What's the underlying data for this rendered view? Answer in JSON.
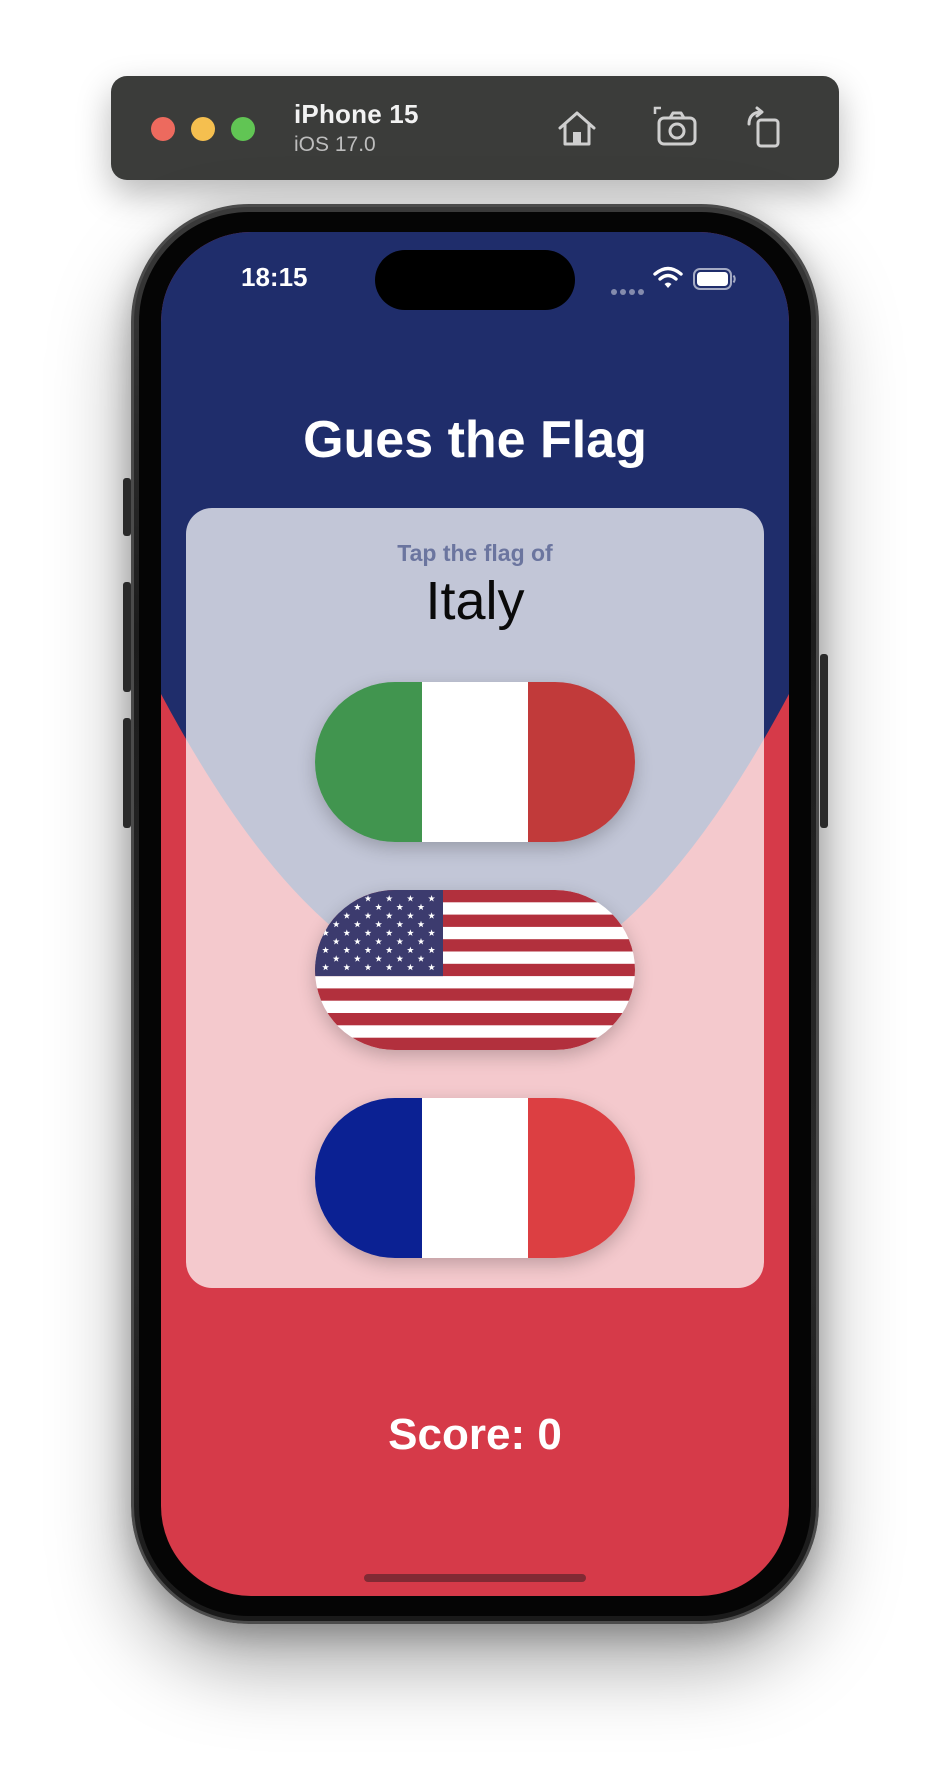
{
  "simulator": {
    "device_name": "iPhone 15",
    "os_version": "iOS 17.0",
    "icons": [
      "home-icon",
      "screenshot-icon",
      "rotate-icon"
    ]
  },
  "status_bar": {
    "time": "18:15",
    "icons": [
      "cellular-dots-icon",
      "wifi-icon",
      "battery-icon"
    ]
  },
  "app": {
    "title": "Gues the Flag",
    "prompt": "Tap the flag of",
    "country": "Italy",
    "flags": [
      {
        "name": "italy",
        "colors": [
          "#41954f",
          "#ffffff",
          "#c13a3a"
        ]
      },
      {
        "name": "usa",
        "colors": [
          "#b2303d",
          "#ffffff",
          "#3c3b6e"
        ]
      },
      {
        "name": "france",
        "colors": [
          "#0b2193",
          "#ffffff",
          "#dc3f42"
        ]
      }
    ],
    "score_text": "Score: 0"
  },
  "colors": {
    "background_top": "#1f2d6b",
    "background_bottom": "#d63a49",
    "card": "rgba(255,255,255,0.73)"
  }
}
